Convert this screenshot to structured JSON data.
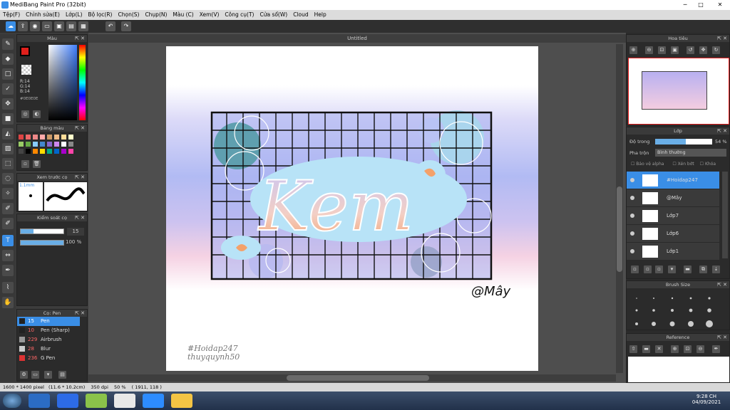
{
  "title": "MediBang Paint Pro (32bit)",
  "menu": [
    "Tệp(F)",
    "Chỉnh sửa(E)",
    "Lớp(L)",
    "Bộ lọc(R)",
    "Chọn(S)",
    "Chụp(N)",
    "Màu (C)",
    "Xem(V)",
    "Công cụ(T)",
    "Cửa sổ(W)",
    "Cloud",
    "Help"
  ],
  "canvas_tab": "Untitled",
  "panels": {
    "color": "Màu",
    "palette": "Bảng màu",
    "preview": "Xem trước cọ",
    "brush_control": "Kiểm soát cọ",
    "brush": "Cọ: Pen",
    "navigator": "Hoa tiêu",
    "layer": "Lớp",
    "brush_size": "Brush Size",
    "reference": "Reference"
  },
  "color_panel": {
    "r": "R:14",
    "g": "G:14",
    "b": "B:14",
    "hex": "#0E0E0E",
    "fg": "#e0201c",
    "bg": "#ffffff"
  },
  "preview_size": "1.1mm",
  "brush_control": {
    "size": "15",
    "opacity": "100 %"
  },
  "brushes": [
    {
      "size": "15",
      "name": "Pen",
      "color": "#222222",
      "selected": true
    },
    {
      "size": "10",
      "name": "Pen (Sharp)",
      "color": "#222222",
      "selected": false
    },
    {
      "size": "229",
      "name": "Airbrush",
      "color": "#999999",
      "selected": false
    },
    {
      "size": "28",
      "name": "Blur",
      "color": "#cccccc",
      "selected": false
    },
    {
      "size": "236",
      "name": "G Pen",
      "color": "#dd3333",
      "selected": false
    }
  ],
  "layer_panel": {
    "opacity_label": "Độ trong",
    "opacity_value": "54 %",
    "blend_label": "Pha trộn",
    "blend_value": "Bình thường",
    "protect_alpha": "Bảo vệ alpha",
    "clipping": "Xén bớt",
    "lock": "Khóa"
  },
  "layers": [
    {
      "name": "#Hoidap247",
      "selected": true
    },
    {
      "name": "@Mây",
      "selected": false
    },
    {
      "name": "Lớp7",
      "selected": false
    },
    {
      "name": "Lớp6",
      "selected": false
    },
    {
      "name": "Lớp1",
      "selected": false
    }
  ],
  "artwork": {
    "title": "Kem",
    "signature": "@Mây",
    "watermark1": "#Hoidap247",
    "watermark2": "thuyquynh50"
  },
  "status": {
    "size": "1600 * 1400 pixel",
    "cm": "(11.6 * 10.2cm)",
    "dpi": "350 dpi",
    "zoom": "50 %",
    "coords": "( 1911, 118 )"
  },
  "taskbar": {
    "time": "9:28 CH",
    "date": "04/09/2021"
  }
}
